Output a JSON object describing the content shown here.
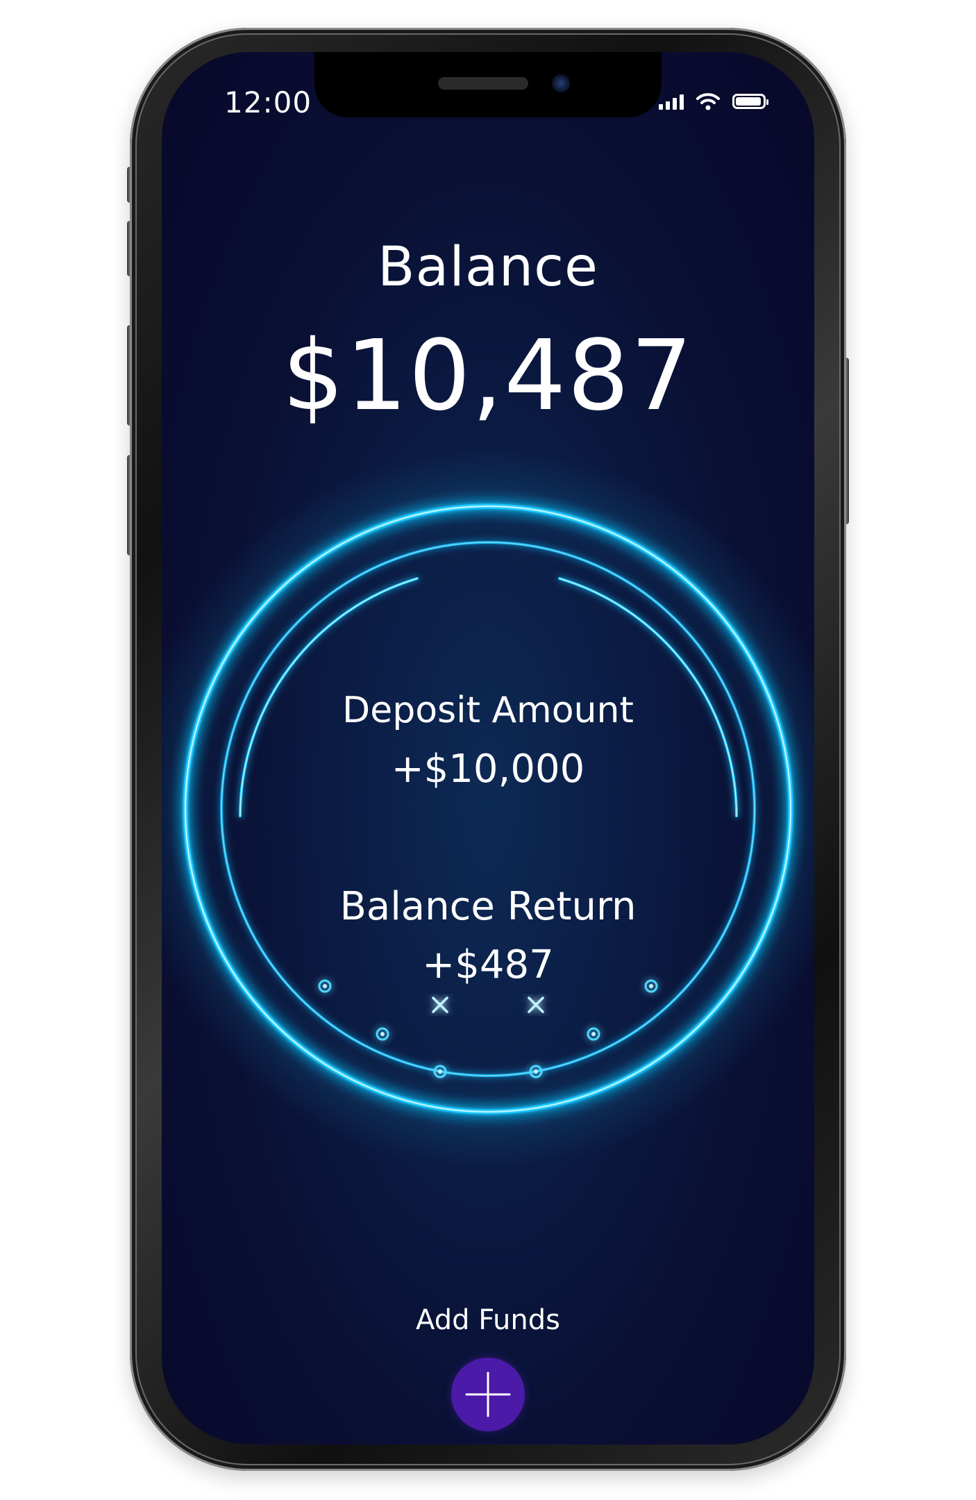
{
  "status_bar": {
    "time": "12:00",
    "battery_level": 0.95,
    "signal_level": 4
  },
  "header": {
    "title": "Balance",
    "amount": "$10,487"
  },
  "ring": {
    "deposit_label": "Deposit Amount",
    "deposit_value": "+$10,000",
    "return_label": "Balance Return",
    "return_value": "+$487"
  },
  "footer": {
    "add_funds_label": "Add Funds"
  },
  "colors": {
    "background_dark": "#08082a",
    "background_center": "#0d2a55",
    "ring_glow": "#1ec8ff",
    "ring_core": "#a8f0ff",
    "button_purple": "#4b1aa8",
    "text": "#ffffff"
  },
  "icons": {
    "add": "plus-icon",
    "wifi": "wifi-icon",
    "signal": "signal-icon",
    "battery": "battery-icon"
  }
}
